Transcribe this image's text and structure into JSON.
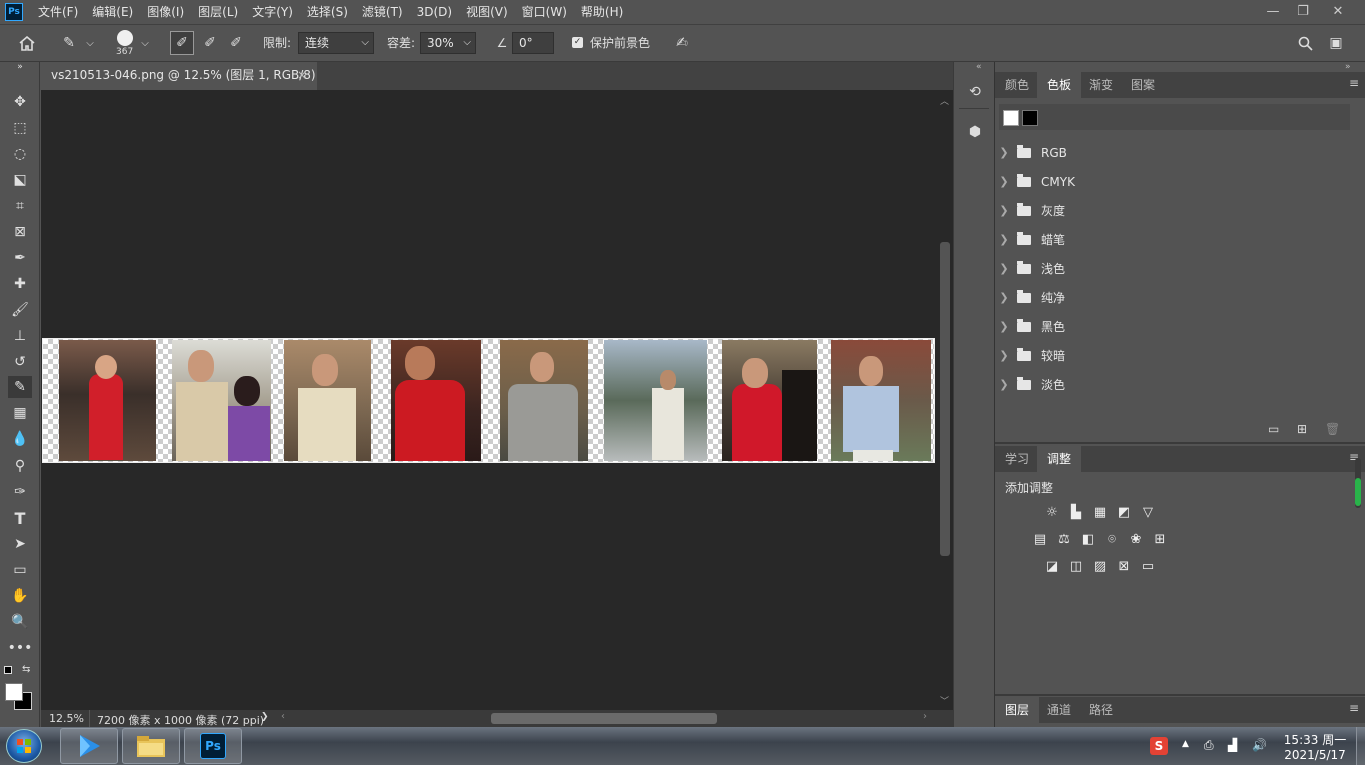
{
  "menubar": {
    "logo": "Ps",
    "items": [
      "文件(F)",
      "编辑(E)",
      "图像(I)",
      "图层(L)",
      "文字(Y)",
      "选择(S)",
      "滤镜(T)",
      "3D(D)",
      "视图(V)",
      "窗口(W)",
      "帮助(H)"
    ]
  },
  "options": {
    "brush_size": "367",
    "limit_label": "限制:",
    "limit_value": "连续",
    "tolerance_label": "容差:",
    "tolerance_value": "30%",
    "angle_value": "0°",
    "protect_label": "保护前景色"
  },
  "document": {
    "tab_title": "vs210513-046.png @ 12.5% (图层 1, RGB/8)",
    "close": "×"
  },
  "status": {
    "zoom": "12.5%",
    "info": "7200 像素 x 1000 像素 (72 ppi)",
    "arrow": "❯"
  },
  "swatches_panel": {
    "tabs": [
      "颜色",
      "色板",
      "渐变",
      "图案"
    ],
    "active_tab": "色板",
    "swatch_colors": [
      "#ffffff",
      "#000000"
    ],
    "groups": [
      "RGB",
      "CMYK",
      "灰度",
      "蜡笔",
      "浅色",
      "纯净",
      "黑色",
      "较暗",
      "淡色"
    ]
  },
  "adjustments_panel": {
    "tabs": [
      "学习",
      "调整"
    ],
    "active_tab": "调整",
    "title": "添加调整"
  },
  "layers_panel": {
    "tabs": [
      "图层",
      "通道",
      "路径"
    ],
    "active_tab": "图层"
  },
  "taskbar": {
    "time": "15:33 周一",
    "date": "2021/5/17"
  },
  "colors": {
    "bg_panel": "#535353",
    "canvas_bg": "#282828",
    "accent_blue": "#31a8ff"
  }
}
